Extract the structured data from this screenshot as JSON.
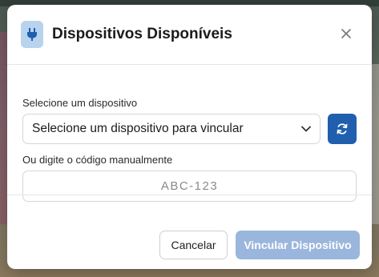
{
  "modal": {
    "title": "Dispositivos Disponíveis",
    "select_label": "Selecione um dispositivo",
    "select_value": "Selecione um dispositivo para vincular",
    "manual_label": "Ou digite o código manualmente",
    "code_placeholder": "ABC-123",
    "cancel_label": "Cancelar",
    "submit_label": "Vincular Dispositivo"
  },
  "icons": {
    "header": "plug-icon",
    "close": "close-icon",
    "dropdown": "chevron-down-icon",
    "refresh": "refresh-icon"
  },
  "colors": {
    "primary": "#1f5fae",
    "primary_disabled": "#9ab6dc",
    "header_icon_bg": "#b9d3ef"
  }
}
